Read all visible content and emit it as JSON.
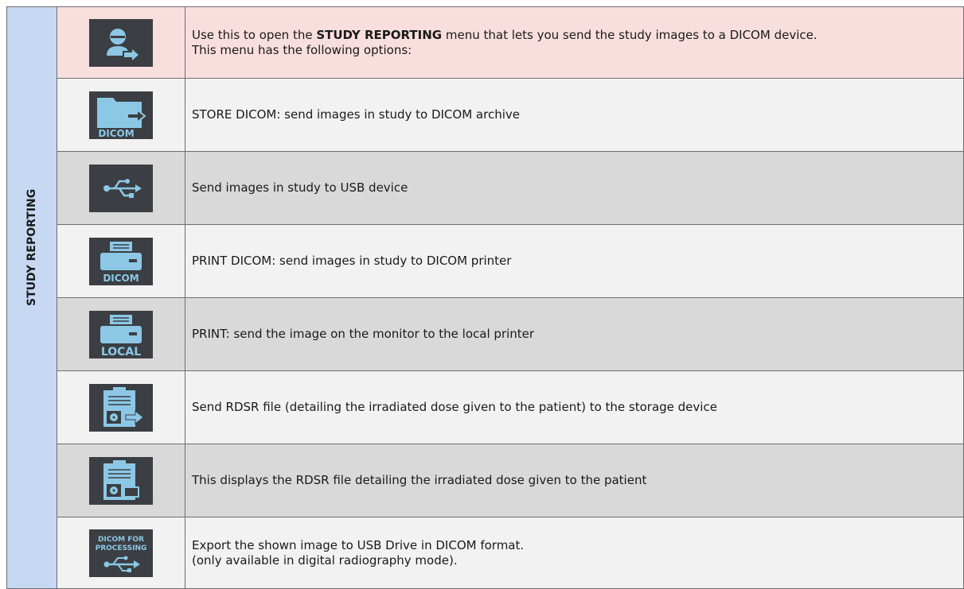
{
  "section_label": "STUDY REPORTING",
  "header_row": {
    "icon": "user-arrow-icon",
    "text_before": "Use this to open the ",
    "text_bold": "STUDY REPORTING",
    "text_after": " menu that lets you send the study images to a DICOM device.",
    "line2": "This menu has the following options:"
  },
  "rows": [
    {
      "icon": "store-dicom-icon",
      "icon_text": "DICOM",
      "text": "STORE DICOM: send images in study to DICOM archive"
    },
    {
      "icon": "usb-icon",
      "text": "Send images in study to USB device"
    },
    {
      "icon": "print-dicom-icon",
      "icon_text": "DICOM",
      "text": "PRINT DICOM: send images in study to DICOM printer"
    },
    {
      "icon": "print-local-icon",
      "icon_text": "LOCAL",
      "text": "PRINT: send the image on the monitor to the local printer"
    },
    {
      "icon": "rdsr-send-icon",
      "text": "Send RDSR file (detailing the irradiated dose given to the patient) to the storage device"
    },
    {
      "icon": "rdsr-display-icon",
      "text": "This displays the RDSR file detailing the irradiated dose given to the patient"
    },
    {
      "icon": "dicom-processing-usb-icon",
      "icon_text_1": "DICOM FOR",
      "icon_text_2": "PROCESSING",
      "text_1": "Export the shown image to USB Drive in DICOM format.",
      "text_2": "(only available in digital radiography mode)."
    }
  ],
  "colors": {
    "icon_bg": "#3b3e42",
    "icon_fg": "#8cc8e6",
    "header_bg": "#f9dede",
    "section_bg": "#c6d8f2"
  }
}
